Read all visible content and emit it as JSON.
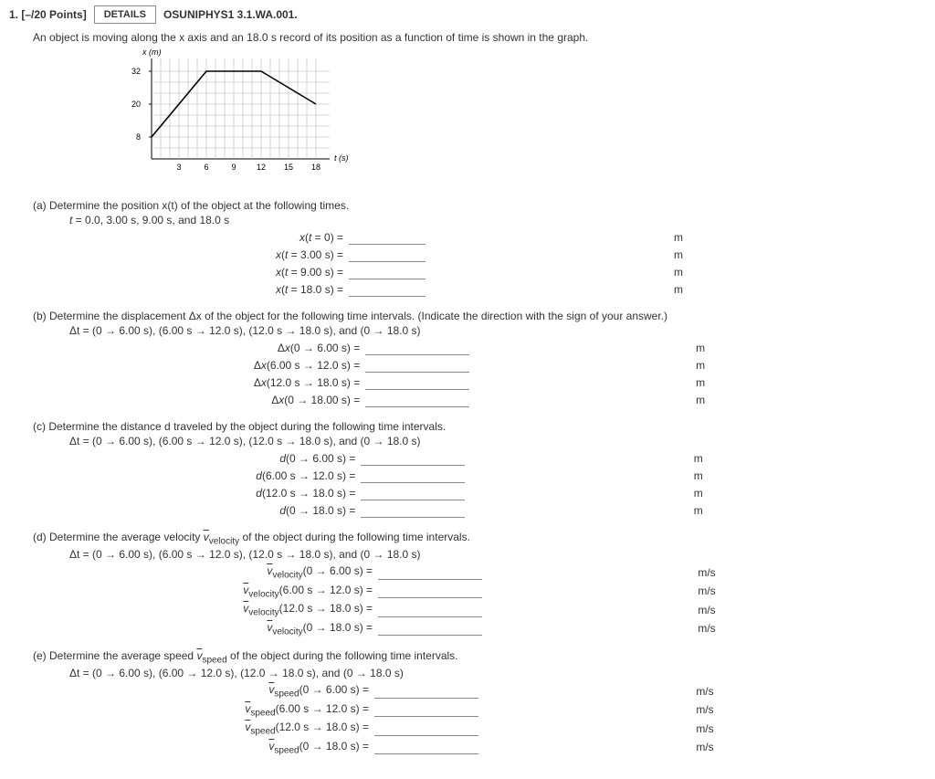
{
  "header": {
    "points": "1. [–/20 Points]",
    "details_label": "DETAILS",
    "source": "OSUNIPHYS1 3.1.WA.001."
  },
  "prompt": "An object is moving along the x axis and an 18.0 s record of its position as a function of time is shown in the graph.",
  "parts": {
    "a": {
      "label": "(a) Determine the position x(t) of the object at the following times.",
      "sub": "t = 0.0, 3.00 s, 9.00 s, and 18.0 s",
      "rows": [
        {
          "lab": "x(t = 0) =",
          "unit": "m"
        },
        {
          "lab": "x(t = 3.00 s) =",
          "unit": "m"
        },
        {
          "lab": "x(t = 9.00 s) =",
          "unit": "m"
        },
        {
          "lab": "x(t = 18.0 s) =",
          "unit": "m"
        }
      ]
    },
    "b": {
      "label": "(b) Determine the displacement Δx of the object for the following time intervals. (Indicate the direction with the sign of your answer.)",
      "sub": "Δt = (0 → 6.00 s), (6.00 s → 12.0 s), (12.0 s → 18.0 s), and (0 → 18.0 s)",
      "rows": [
        {
          "lab": "Δx(0 → 6.00 s) =",
          "unit": "m"
        },
        {
          "lab": "Δx(6.00 s → 12.0 s) =",
          "unit": "m"
        },
        {
          "lab": "Δx(12.0 s → 18.0 s) =",
          "unit": "m"
        },
        {
          "lab": "Δx(0 → 18.00 s) =",
          "unit": "m"
        }
      ]
    },
    "c": {
      "label": "(c) Determine the distance d traveled by the object during the following time intervals.",
      "sub": "Δt = (0 → 6.00 s), (6.00 s → 12.0 s), (12.0 s → 18.0 s), and (0 → 18.0 s)",
      "rows": [
        {
          "lab": "d(0 → 6.00 s) =",
          "unit": "m"
        },
        {
          "lab": "d(6.00 s → 12.0 s) =",
          "unit": "m"
        },
        {
          "lab": "d(12.0 s → 18.0 s) =",
          "unit": "m"
        },
        {
          "lab": "d(0 → 18.0 s) =",
          "unit": "m"
        }
      ]
    },
    "d": {
      "label_pre": "(d) Determine the average velocity ",
      "label_mid": "velocity",
      "label_post": " of the object during the following time intervals.",
      "sub": "Δt = (0 → 6.00 s), (6.00 s → 12.0 s), (12.0 s → 18.0 s), and (0 → 18.0 s)",
      "rows": [
        {
          "lab": "(0 → 6.00 s) =",
          "unit": "m/s"
        },
        {
          "lab": "(6.00 s → 12.0 s) =",
          "unit": "m/s"
        },
        {
          "lab": "(12.0 s → 18.0 s) =",
          "unit": "m/s"
        },
        {
          "lab": "(0 → 18.0 s) =",
          "unit": "m/s"
        }
      ]
    },
    "e": {
      "label_pre": "(e) Determine the average speed ",
      "label_mid": "speed",
      "label_post": " of the object during the following time intervals.",
      "sub": "Δt = (0 → 6.00 s), (6.00 → 12.0 s), (12.0 → 18.0 s), and (0 → 18.0 s)",
      "rows": [
        {
          "lab": "(0 → 6.00 s) =",
          "unit": "m/s"
        },
        {
          "lab": "(6.00 s → 12.0 s) =",
          "unit": "m/s"
        },
        {
          "lab": "(12.0 s → 18.0 s) =",
          "unit": "m/s"
        },
        {
          "lab": "(0 → 18.0 s) =",
          "unit": "m/s"
        }
      ]
    }
  },
  "chart_data": {
    "type": "line",
    "xlabel": "t (s)",
    "ylabel": "x (m)",
    "x_ticks": [
      3,
      6,
      9,
      12,
      15,
      18
    ],
    "y_ticks": [
      8,
      20,
      32
    ],
    "xlim": [
      0,
      20
    ],
    "ylim": [
      0,
      36
    ],
    "series": [
      {
        "name": "x(t)",
        "points": [
          [
            0,
            8
          ],
          [
            6,
            32
          ],
          [
            12,
            32
          ],
          [
            18,
            20
          ]
        ]
      }
    ]
  }
}
